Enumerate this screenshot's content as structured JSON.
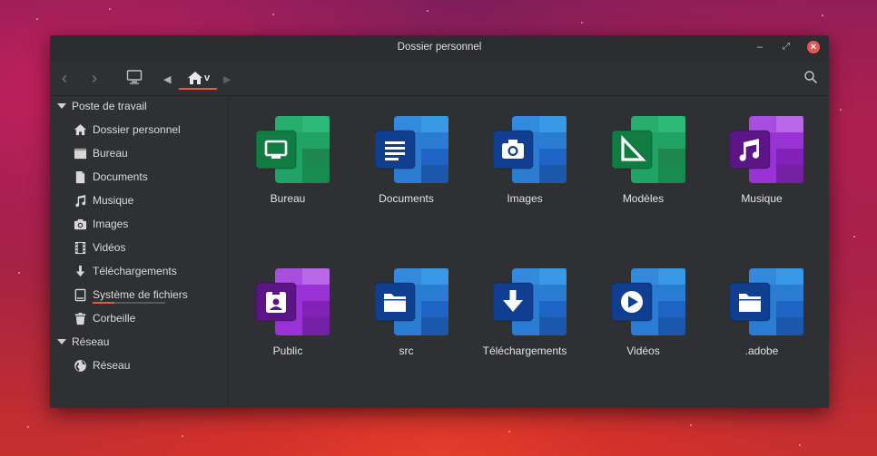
{
  "window": {
    "title": "Dossier personnel"
  },
  "toolbar": {
    "path_label": "v",
    "icons": [
      "back-arrow-icon",
      "forward-arrow-icon",
      "computer-icon",
      "path-left-icon",
      "home-icon",
      "path-right-icon",
      "search-icon"
    ]
  },
  "sidebar": {
    "sections": [
      {
        "title": "Poste de travail",
        "items": [
          {
            "label": "Dossier personnel",
            "icon": "home-icon"
          },
          {
            "label": "Bureau",
            "icon": "desktop-icon"
          },
          {
            "label": "Documents",
            "icon": "document-icon"
          },
          {
            "label": "Musique",
            "icon": "music-icon"
          },
          {
            "label": "Images",
            "icon": "camera-icon"
          },
          {
            "label": "Vidéos",
            "icon": "film-icon"
          },
          {
            "label": "Téléchargements",
            "icon": "download-icon"
          },
          {
            "label": "Système de fichiers",
            "icon": "drive-icon",
            "usage": 0.3
          },
          {
            "label": "Corbeille",
            "icon": "trash-icon"
          }
        ]
      },
      {
        "title": "Réseau",
        "items": [
          {
            "label": "Réseau",
            "icon": "globe-icon"
          }
        ]
      }
    ]
  },
  "files": [
    {
      "label": "Bureau",
      "icon": "desktop-icon",
      "palette": "green"
    },
    {
      "label": "Documents",
      "icon": "document-lines-icon",
      "palette": "blue"
    },
    {
      "label": "Images",
      "icon": "camera-icon",
      "palette": "blue"
    },
    {
      "label": "Modèles",
      "icon": "set-square-icon",
      "palette": "green"
    },
    {
      "label": "Musique",
      "icon": "music-icon",
      "palette": "purple"
    },
    {
      "label": "Public",
      "icon": "person-badge-icon",
      "palette": "purple"
    },
    {
      "label": "src",
      "icon": "folder-icon",
      "palette": "blue"
    },
    {
      "label": "Téléchargements",
      "icon": "download-icon",
      "palette": "blue"
    },
    {
      "label": "Vidéos",
      "icon": "play-icon",
      "palette": "blue"
    },
    {
      "label": ".adobe",
      "icon": "folder-icon",
      "palette": "blue"
    }
  ],
  "colors": {
    "accent": "#e65a3c",
    "window_bg": "#2e3033",
    "close_button": "#e05a5a",
    "green": [
      "#1d7a45",
      "#21a366",
      "#107c41",
      "#33c481"
    ],
    "blue": [
      "#185abd",
      "#2b7cd3",
      "#103f91",
      "#41a5ee"
    ],
    "purple": [
      "#7719aa",
      "#9a33d6",
      "#5c1584",
      "#c77ef0"
    ]
  }
}
